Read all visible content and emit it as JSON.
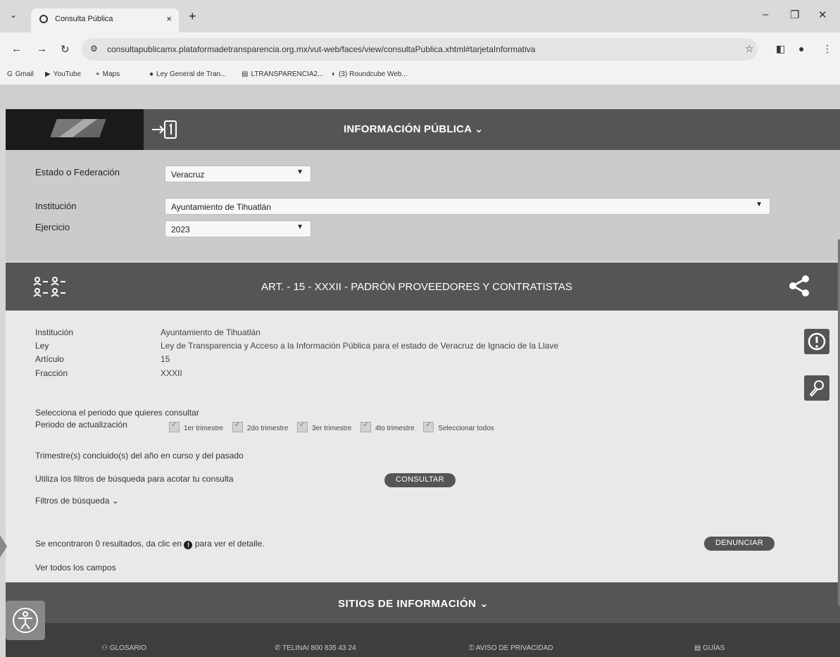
{
  "browser": {
    "tab_title": "Consulta Pública",
    "tab_close": "×",
    "new_tab": "+",
    "url": "consultapublicamx.plataformadetransparencia.org.mx/vut-web/faces/view/consultaPublica.xhtml#tarjetaInformativa",
    "bookmarks": [
      {
        "label": "Gmail",
        "icon": "G"
      },
      {
        "label": "YouTube",
        "icon": "▶"
      },
      {
        "label": "Maps",
        "icon": "⌖"
      },
      {
        "label": "Ley General de Tran...",
        "icon": "●"
      },
      {
        "label": "LTRANSPARENCIA2...",
        "icon": "▤"
      },
      {
        "label": "(3) Roundcube Web...",
        "icon": "◐"
      }
    ]
  },
  "header": {
    "title": "INFORMACIÓN PÚBLICA ⌄"
  },
  "filters": {
    "estado_label": "Estado o Federación",
    "estado_value": "Veracruz",
    "institucion_label": "Institución",
    "institucion_value": "Ayuntamiento de Tihuatlán",
    "ejercicio_label": "Ejercicio",
    "ejercicio_value": "2023"
  },
  "article": {
    "title": "ART. - 15 - XXXII - PADRÓN PROVEEDORES Y CONTRATISTAS",
    "details": [
      {
        "key": "Institución",
        "value": "Ayuntamiento de Tihuatlán"
      },
      {
        "key": "Ley",
        "value": "Ley de Transparencia y Acceso a la Información Pública para el estado de Veracruz de Ignacio de la Llave"
      },
      {
        "key": "Artículo",
        "value": "15"
      },
      {
        "key": "Fracción",
        "value": "XXXII"
      }
    ],
    "select_period_text": "Selecciona el periodo que quieres consultar",
    "periodo_label": "Periodo de actualización",
    "periods": [
      "1er trimestre",
      "2do trimestre",
      "3er trimestre",
      "4to trimestre",
      "Seleccionar todos"
    ],
    "concluded_text": "Trimestre(s) concluido(s) del año en curso y del pasado",
    "filters_hint": "Utiliza los filtros de búsqueda para acotar tu consulta",
    "consultar_button": "CONSULTAR",
    "search_filters_toggle": "Filtros de búsqueda ⌄",
    "results_text_before": "Se encontraron 0 resultados, da clic en",
    "results_text_after": "para ver el detalle.",
    "denunciar_button": "DENUNCIAR",
    "ver_todos": "Ver todos los campos"
  },
  "footer": {
    "title": "SITIOS DE INFORMACIÓN ⌄",
    "links": [
      "GLOSARIO",
      "TELINAI 800 835 43 24",
      "AVISO DE PRIVACIDAD",
      "GUÍAS"
    ]
  }
}
